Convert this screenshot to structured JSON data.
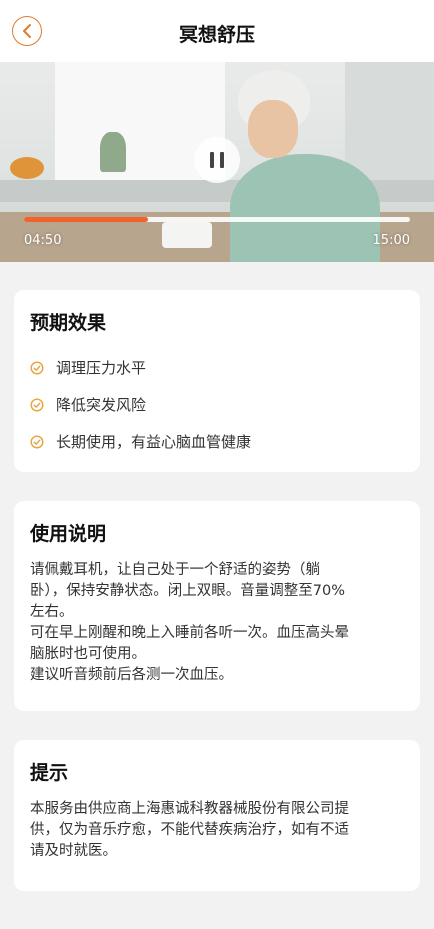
{
  "header": {
    "title": "冥想舒压"
  },
  "player": {
    "current_time": "04:50",
    "total_time": "15:00",
    "progress": 0.322,
    "accent_color": "#f0632c",
    "state_icon": "pause-icon"
  },
  "effects": {
    "title": "预期效果",
    "icon": "check-circle-icon",
    "icon_color": "#e9a23b",
    "items": [
      "调理压力水平",
      "降低突发风险",
      "长期使用，有益心脑血管健康"
    ]
  },
  "instructions": {
    "title": "使用说明",
    "lines": [
      "请佩戴耳机，让自己处于一个舒适的姿势（躺",
      "卧），保持安静状态。闭上双眼。音量调整至70%",
      "左右。",
      "可在早上刚醒和晚上入睡前各听一次。血压高头晕",
      "脑胀时也可使用。",
      "建议听音频前后各测一次血压。"
    ]
  },
  "tips": {
    "title": "提示",
    "lines": [
      "本服务由供应商上海惠诚科教器械股份有限公司提",
      "供，仅为音乐疗愈，不能代替疾病治疗，如有不适",
      "请及时就医。"
    ]
  }
}
